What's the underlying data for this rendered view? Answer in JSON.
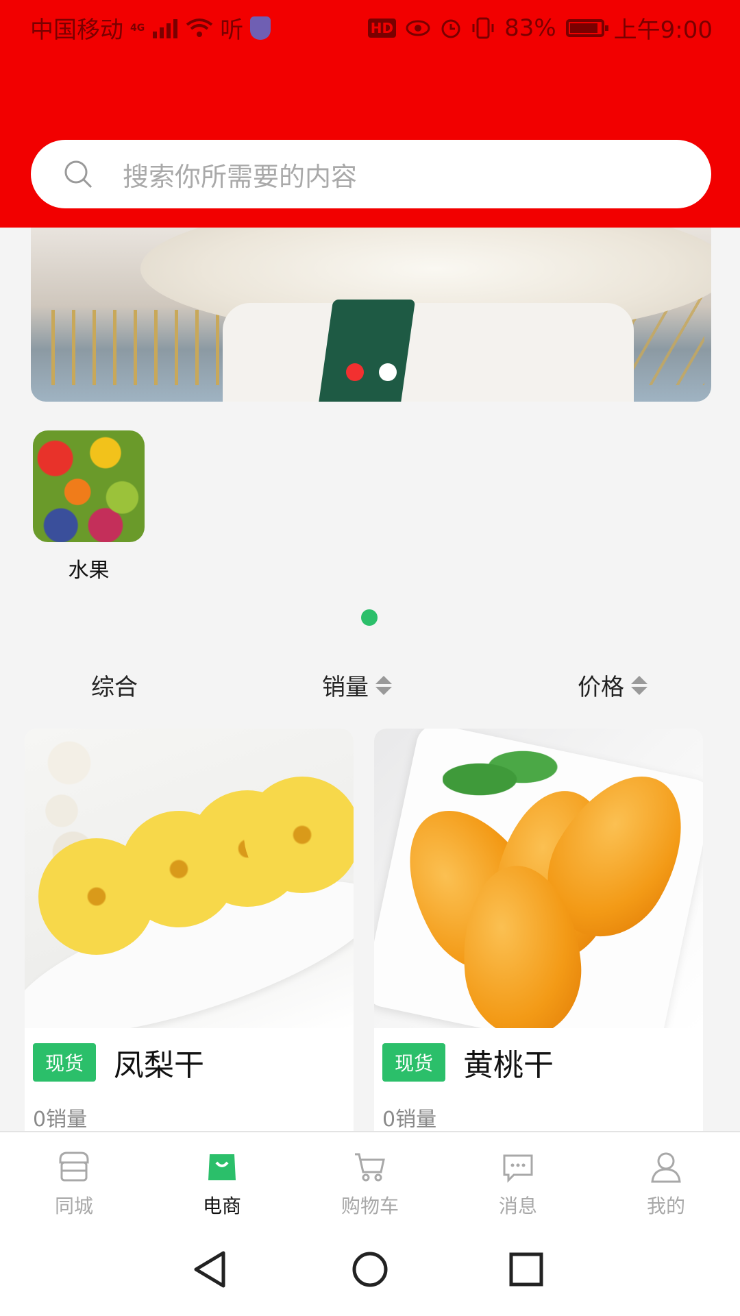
{
  "status_bar": {
    "carrier": "中国移动",
    "signal_label": "4G",
    "app_glyph": "听",
    "hd_badge": "HD",
    "battery": "83%",
    "time": "上午9:00"
  },
  "search": {
    "placeholder": "搜索你所需要的内容",
    "icon": "search-icon"
  },
  "banner": {
    "active_index": 0,
    "count": 2,
    "active_dot_color": "#f23030"
  },
  "categories": [
    {
      "label": "水果"
    }
  ],
  "sort_bar": {
    "items": [
      {
        "label": "综合"
      },
      {
        "label": "销量"
      },
      {
        "label": "价格"
      }
    ]
  },
  "products": [
    {
      "tag": "现货",
      "name": "凤梨干",
      "sales": "0销量"
    },
    {
      "tag": "现货",
      "name": "黄桃干",
      "sales": "0销量"
    }
  ],
  "tab_bar": {
    "items": [
      {
        "label": "同城",
        "icon": "store-icon"
      },
      {
        "label": "电商",
        "icon": "shopping-bag-icon",
        "active": true
      },
      {
        "label": "购物车",
        "icon": "cart-icon"
      },
      {
        "label": "消息",
        "icon": "message-icon"
      },
      {
        "label": "我的",
        "icon": "user-icon"
      }
    ]
  },
  "colors": {
    "header": "#f20000",
    "accent_green": "#2bbf6a",
    "inactive_tab": "#a8a8a8"
  }
}
